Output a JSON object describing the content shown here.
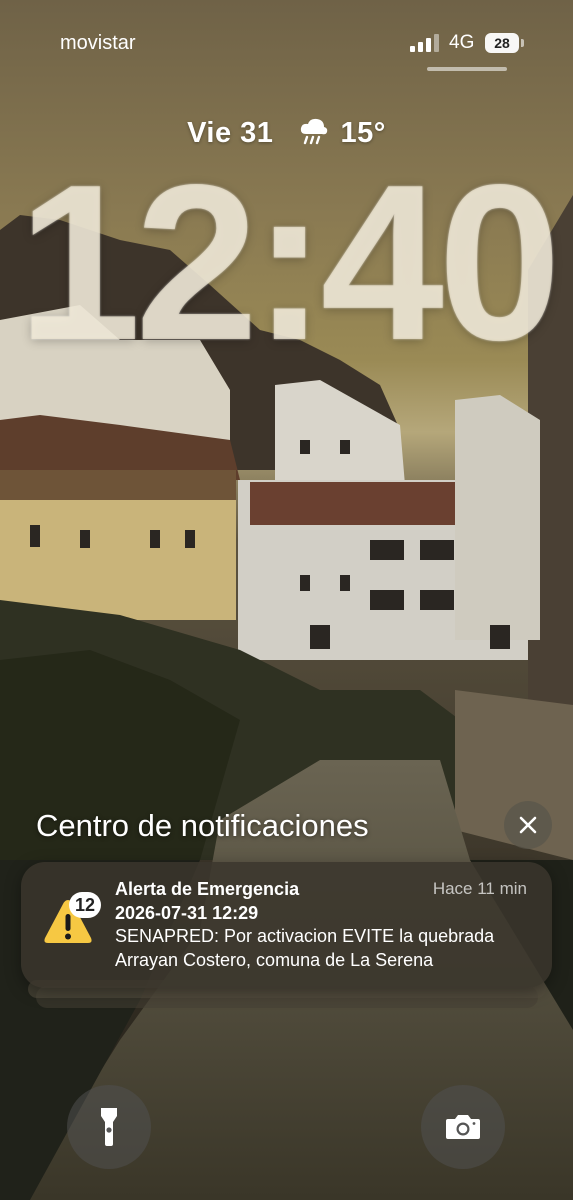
{
  "status_bar": {
    "carrier": "movistar",
    "network": "4G",
    "battery": "28"
  },
  "lock_screen": {
    "date": "Vie 31",
    "temperature": "15°",
    "weather_icon": "cloud-rain-icon",
    "time": "12:40"
  },
  "notification_center": {
    "title": "Centro de notificaciones"
  },
  "notification": {
    "icon": "warning-triangle-icon",
    "badge_count": "12",
    "app": "Alerta de Emergencia",
    "time_ago": "Hace 11 min",
    "subtitle": "2026-07-31 12:29",
    "body": "SENAPRED: Por activacion EVITE la quebrada Arrayan Costero, comuna de La Serena"
  },
  "quick_actions": {
    "left_icon": "flashlight-icon",
    "right_icon": "camera-icon"
  },
  "colors": {
    "alert_yellow": "#F6C843",
    "card_bg": "#3A362C"
  }
}
